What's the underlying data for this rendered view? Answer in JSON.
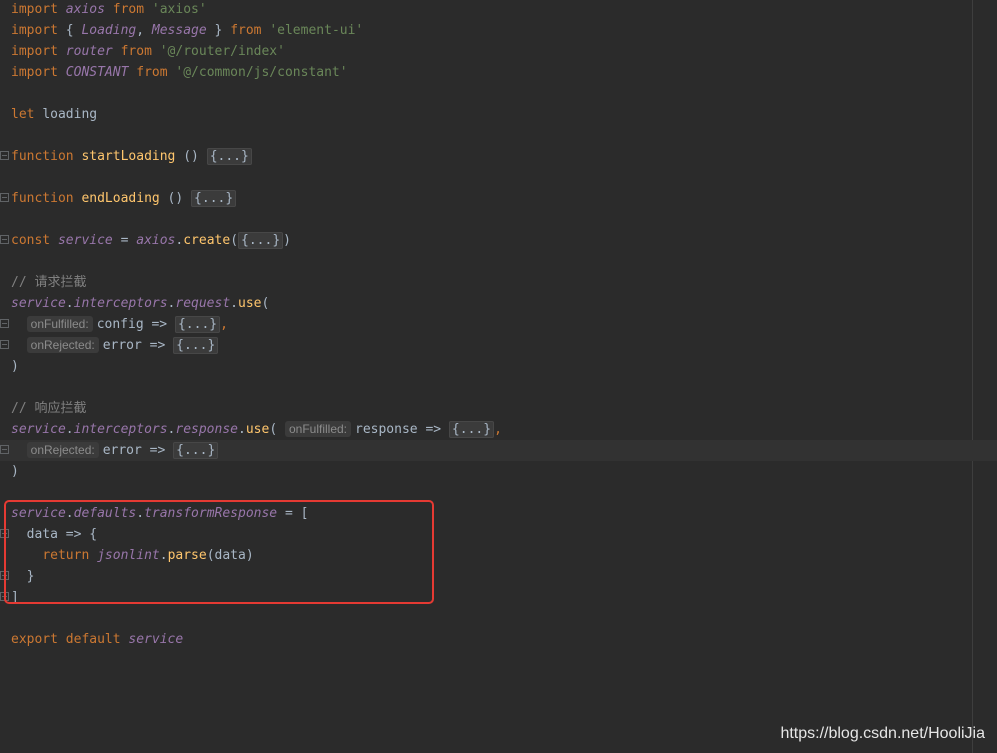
{
  "lines": [
    {
      "tokens": [
        {
          "c": "kw",
          "t": "import "
        },
        {
          "c": "id",
          "t": "axios"
        },
        {
          "c": "kw",
          "t": " from "
        },
        {
          "c": "str",
          "t": "'axios'"
        }
      ]
    },
    {
      "tokens": [
        {
          "c": "kw",
          "t": "import "
        },
        {
          "c": "plain",
          "t": "{ "
        },
        {
          "c": "id",
          "t": "Loading"
        },
        {
          "c": "plain",
          "t": ", "
        },
        {
          "c": "id",
          "t": "Message"
        },
        {
          "c": "plain",
          "t": " } "
        },
        {
          "c": "kw",
          "t": "from "
        },
        {
          "c": "str",
          "t": "'element-ui'"
        }
      ]
    },
    {
      "tokens": [
        {
          "c": "kw",
          "t": "import "
        },
        {
          "c": "id",
          "t": "router"
        },
        {
          "c": "kw",
          "t": " from "
        },
        {
          "c": "str",
          "t": "'@/router/index'"
        }
      ]
    },
    {
      "tokens": [
        {
          "c": "kw",
          "t": "import "
        },
        {
          "c": "id",
          "t": "CONSTANT"
        },
        {
          "c": "kw",
          "t": " from "
        },
        {
          "c": "str",
          "t": "'@/common/js/constant'"
        }
      ]
    },
    {
      "tokens": []
    },
    {
      "tokens": [
        {
          "c": "kw",
          "t": "let "
        },
        {
          "c": "plain",
          "t": "loading"
        }
      ]
    },
    {
      "tokens": []
    },
    {
      "fold": true,
      "tokens": [
        {
          "c": "kw",
          "t": "function "
        },
        {
          "c": "fn",
          "t": "startLoading"
        },
        {
          "c": "plain",
          "t": " () "
        },
        {
          "c": "fold",
          "t": "{...}"
        }
      ]
    },
    {
      "tokens": []
    },
    {
      "fold": true,
      "tokens": [
        {
          "c": "kw",
          "t": "function "
        },
        {
          "c": "fn",
          "t": "endLoading"
        },
        {
          "c": "plain",
          "t": " () "
        },
        {
          "c": "fold",
          "t": "{...}"
        }
      ]
    },
    {
      "tokens": []
    },
    {
      "fold": true,
      "tokens": [
        {
          "c": "kw",
          "t": "const "
        },
        {
          "c": "id",
          "t": "service"
        },
        {
          "c": "plain",
          "t": " = "
        },
        {
          "c": "id",
          "t": "axios"
        },
        {
          "c": "plain",
          "t": "."
        },
        {
          "c": "fn",
          "t": "create"
        },
        {
          "c": "plain",
          "t": "("
        },
        {
          "c": "fold",
          "t": "{...}"
        },
        {
          "c": "plain",
          "t": ")"
        }
      ]
    },
    {
      "tokens": []
    },
    {
      "tokens": [
        {
          "c": "cmt",
          "t": "// 请求拦截"
        }
      ]
    },
    {
      "tokens": [
        {
          "c": "id",
          "t": "service"
        },
        {
          "c": "plain",
          "t": "."
        },
        {
          "c": "id",
          "t": "interceptors"
        },
        {
          "c": "plain",
          "t": "."
        },
        {
          "c": "id",
          "t": "request"
        },
        {
          "c": "plain",
          "t": "."
        },
        {
          "c": "fn",
          "t": "use"
        },
        {
          "c": "plain",
          "t": "("
        }
      ]
    },
    {
      "fold": true,
      "tokens": [
        {
          "c": "plain",
          "t": "  "
        },
        {
          "c": "hint",
          "t": "onFulfilled:"
        },
        {
          "c": "plain",
          "t": "config => "
        },
        {
          "c": "fold",
          "t": "{...}"
        },
        {
          "c": "kw",
          "t": ","
        }
      ]
    },
    {
      "fold": true,
      "tokens": [
        {
          "c": "plain",
          "t": "  "
        },
        {
          "c": "hint",
          "t": "onRejected:"
        },
        {
          "c": "plain",
          "t": "error => "
        },
        {
          "c": "fold",
          "t": "{...}"
        }
      ]
    },
    {
      "tokens": [
        {
          "c": "plain",
          "t": ")"
        }
      ]
    },
    {
      "tokens": []
    },
    {
      "tokens": [
        {
          "c": "cmt",
          "t": "// 响应拦截"
        }
      ]
    },
    {
      "tokens": [
        {
          "c": "id",
          "t": "service"
        },
        {
          "c": "plain",
          "t": "."
        },
        {
          "c": "id",
          "t": "interceptors"
        },
        {
          "c": "plain",
          "t": "."
        },
        {
          "c": "id",
          "t": "response"
        },
        {
          "c": "plain",
          "t": "."
        },
        {
          "c": "fn",
          "t": "use"
        },
        {
          "c": "plain",
          "t": "( "
        },
        {
          "c": "hint",
          "t": "onFulfilled:"
        },
        {
          "c": "plain",
          "t": "response => "
        },
        {
          "c": "fold",
          "t": "{...}"
        },
        {
          "c": "kw",
          "t": ","
        }
      ]
    },
    {
      "current": true,
      "fold": true,
      "tokens": [
        {
          "c": "plain",
          "t": "  "
        },
        {
          "c": "hint",
          "t": "onRejected:"
        },
        {
          "c": "plain",
          "t": "error => "
        },
        {
          "c": "fold",
          "t": "{...}"
        }
      ]
    },
    {
      "tokens": [
        {
          "c": "plain",
          "t": ")"
        }
      ]
    },
    {
      "tokens": []
    },
    {
      "tokens": [
        {
          "c": "id",
          "t": "service"
        },
        {
          "c": "plain",
          "t": "."
        },
        {
          "c": "id",
          "t": "defaults"
        },
        {
          "c": "plain",
          "t": "."
        },
        {
          "c": "id",
          "t": "transformResponse"
        },
        {
          "c": "plain",
          "t": " = ["
        }
      ]
    },
    {
      "fold": true,
      "tokens": [
        {
          "c": "plain",
          "t": "  data => {"
        }
      ]
    },
    {
      "tokens": [
        {
          "c": "plain",
          "t": "    "
        },
        {
          "c": "kw",
          "t": "return "
        },
        {
          "c": "id",
          "t": "jsonlint"
        },
        {
          "c": "plain",
          "t": "."
        },
        {
          "c": "fn",
          "t": "parse"
        },
        {
          "c": "plain",
          "t": "(data)"
        }
      ]
    },
    {
      "fold": true,
      "tokens": [
        {
          "c": "plain",
          "t": "  }"
        }
      ]
    },
    {
      "fold": true,
      "tokens": [
        {
          "c": "plain",
          "t": "]"
        }
      ]
    },
    {
      "tokens": []
    },
    {
      "tokens": [
        {
          "c": "kw",
          "t": "export default "
        },
        {
          "c": "id",
          "t": "service"
        }
      ]
    }
  ],
  "watermark": "https://blog.csdn.net/HooliJia",
  "colors": {
    "background": "#2b2b2b",
    "keyword": "#cc7832",
    "identifier": "#9876aa",
    "function": "#ffc66d",
    "string": "#6a8759",
    "comment": "#808080",
    "highlight_box": "#e53a33"
  }
}
